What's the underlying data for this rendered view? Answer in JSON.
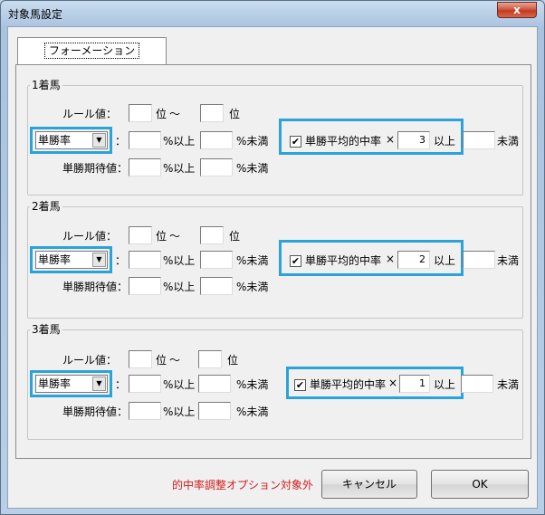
{
  "window": {
    "title": "対象馬設定",
    "close_label": "x"
  },
  "tabs": [
    {
      "label": "フォーメーション"
    }
  ],
  "labels": {
    "rule_value": "ルール値：",
    "rank": "位",
    "tilde": "〜",
    "colon": "：",
    "pct_over": "%以上",
    "pct_under": "%未満",
    "expected_value": "単勝期待値：",
    "avg_hit_rate": "単勝平均的中率",
    "times": "×",
    "over": "以上",
    "under": "未満"
  },
  "groups": [
    {
      "title": "1着馬",
      "rule_from": "",
      "rule_to": "",
      "select_value": "単勝率",
      "rate_min": "",
      "rate_max": "",
      "expect_min": "",
      "expect_max": "",
      "check_checked": true,
      "check_mark": "✔",
      "multiplier": "3",
      "under_value": ""
    },
    {
      "title": "2着馬",
      "rule_from": "",
      "rule_to": "",
      "select_value": "単勝率",
      "rate_min": "",
      "rate_max": "",
      "expect_min": "",
      "expect_max": "",
      "check_checked": true,
      "check_mark": "✔",
      "multiplier": "2",
      "under_value": ""
    },
    {
      "title": "3着馬",
      "rule_from": "",
      "rule_to": "",
      "select_value": "単勝率",
      "rate_min": "",
      "rate_max": "",
      "expect_min": "",
      "expect_max": "",
      "check_checked": true,
      "check_mark": "✔",
      "multiplier": "1",
      "under_value": ""
    }
  ],
  "footer": {
    "note": "的中率調整オプション対象外",
    "cancel_label": "キャンセル",
    "ok_label": "OK"
  },
  "colors": {
    "highlight": "#2aa3d8",
    "note": "#d21b1b",
    "close": "#c13a21"
  },
  "icons": {
    "select_arrow": "chevron-down-icon",
    "check": "checkmark-icon"
  }
}
